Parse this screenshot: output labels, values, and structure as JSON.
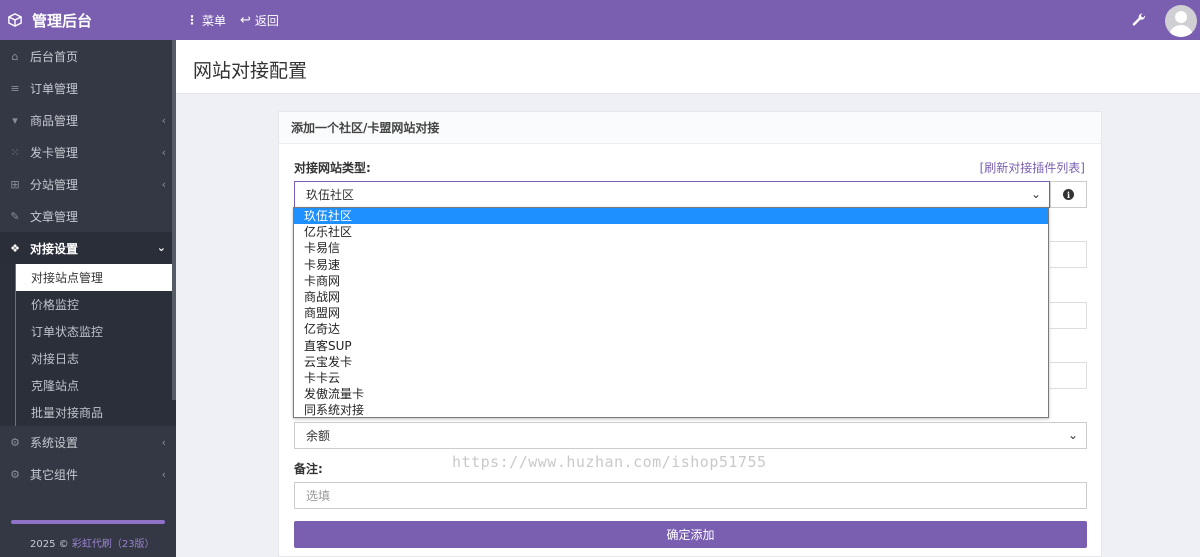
{
  "topbar": {
    "brand": "管理后台",
    "menu_label": "菜单",
    "back_label": "返回"
  },
  "sidebar": {
    "items": [
      {
        "label": "后台首页",
        "icon": "home-icon"
      },
      {
        "label": "订单管理",
        "icon": "list-icon"
      },
      {
        "label": "商品管理",
        "icon": "cart-icon"
      },
      {
        "label": "发卡管理",
        "icon": "grid-icon"
      },
      {
        "label": "分站管理",
        "icon": "sitemap-icon"
      },
      {
        "label": "文章管理",
        "icon": "edit-icon"
      },
      {
        "label": "对接设置",
        "icon": "cubes-icon"
      }
    ],
    "sub_items": [
      "对接站点管理",
      "价格监控",
      "订单状态监控",
      "对接日志",
      "克隆站点",
      "批量对接商品"
    ],
    "bottom_items": [
      {
        "label": "系统设置",
        "icon": "gear-icon"
      },
      {
        "label": "其它组件",
        "icon": "cogs-icon"
      }
    ],
    "footer_year": "2025 ©",
    "footer_link": "彩虹代刷",
    "footer_version": "（23版）"
  },
  "page": {
    "title": "网站对接配置"
  },
  "form": {
    "card_title": "添加一个社区/卡盟网站对接",
    "type_label": "对接网站类型:",
    "refresh_link": "[刷新对接插件列表]",
    "selected_type": "玖伍社区",
    "balance_select": "余额",
    "note_label": "备注:",
    "note_placeholder": "选填",
    "submit_label": "确定添加"
  },
  "dropdown_options": [
    "玖伍社区",
    "亿乐社区",
    "卡易信",
    "卡易速",
    "卡商网",
    "商战网",
    "商盟网",
    "亿奇达",
    "直客SUP",
    "云宝发卡",
    "卡卡云",
    "发傲流量卡",
    "同系统对接"
  ],
  "watermark": "https://www.huzhan.com/ishop51755",
  "colors": {
    "accent": "#7a5fb0",
    "sidebar": "#333844",
    "highlight": "#1e90ff"
  }
}
